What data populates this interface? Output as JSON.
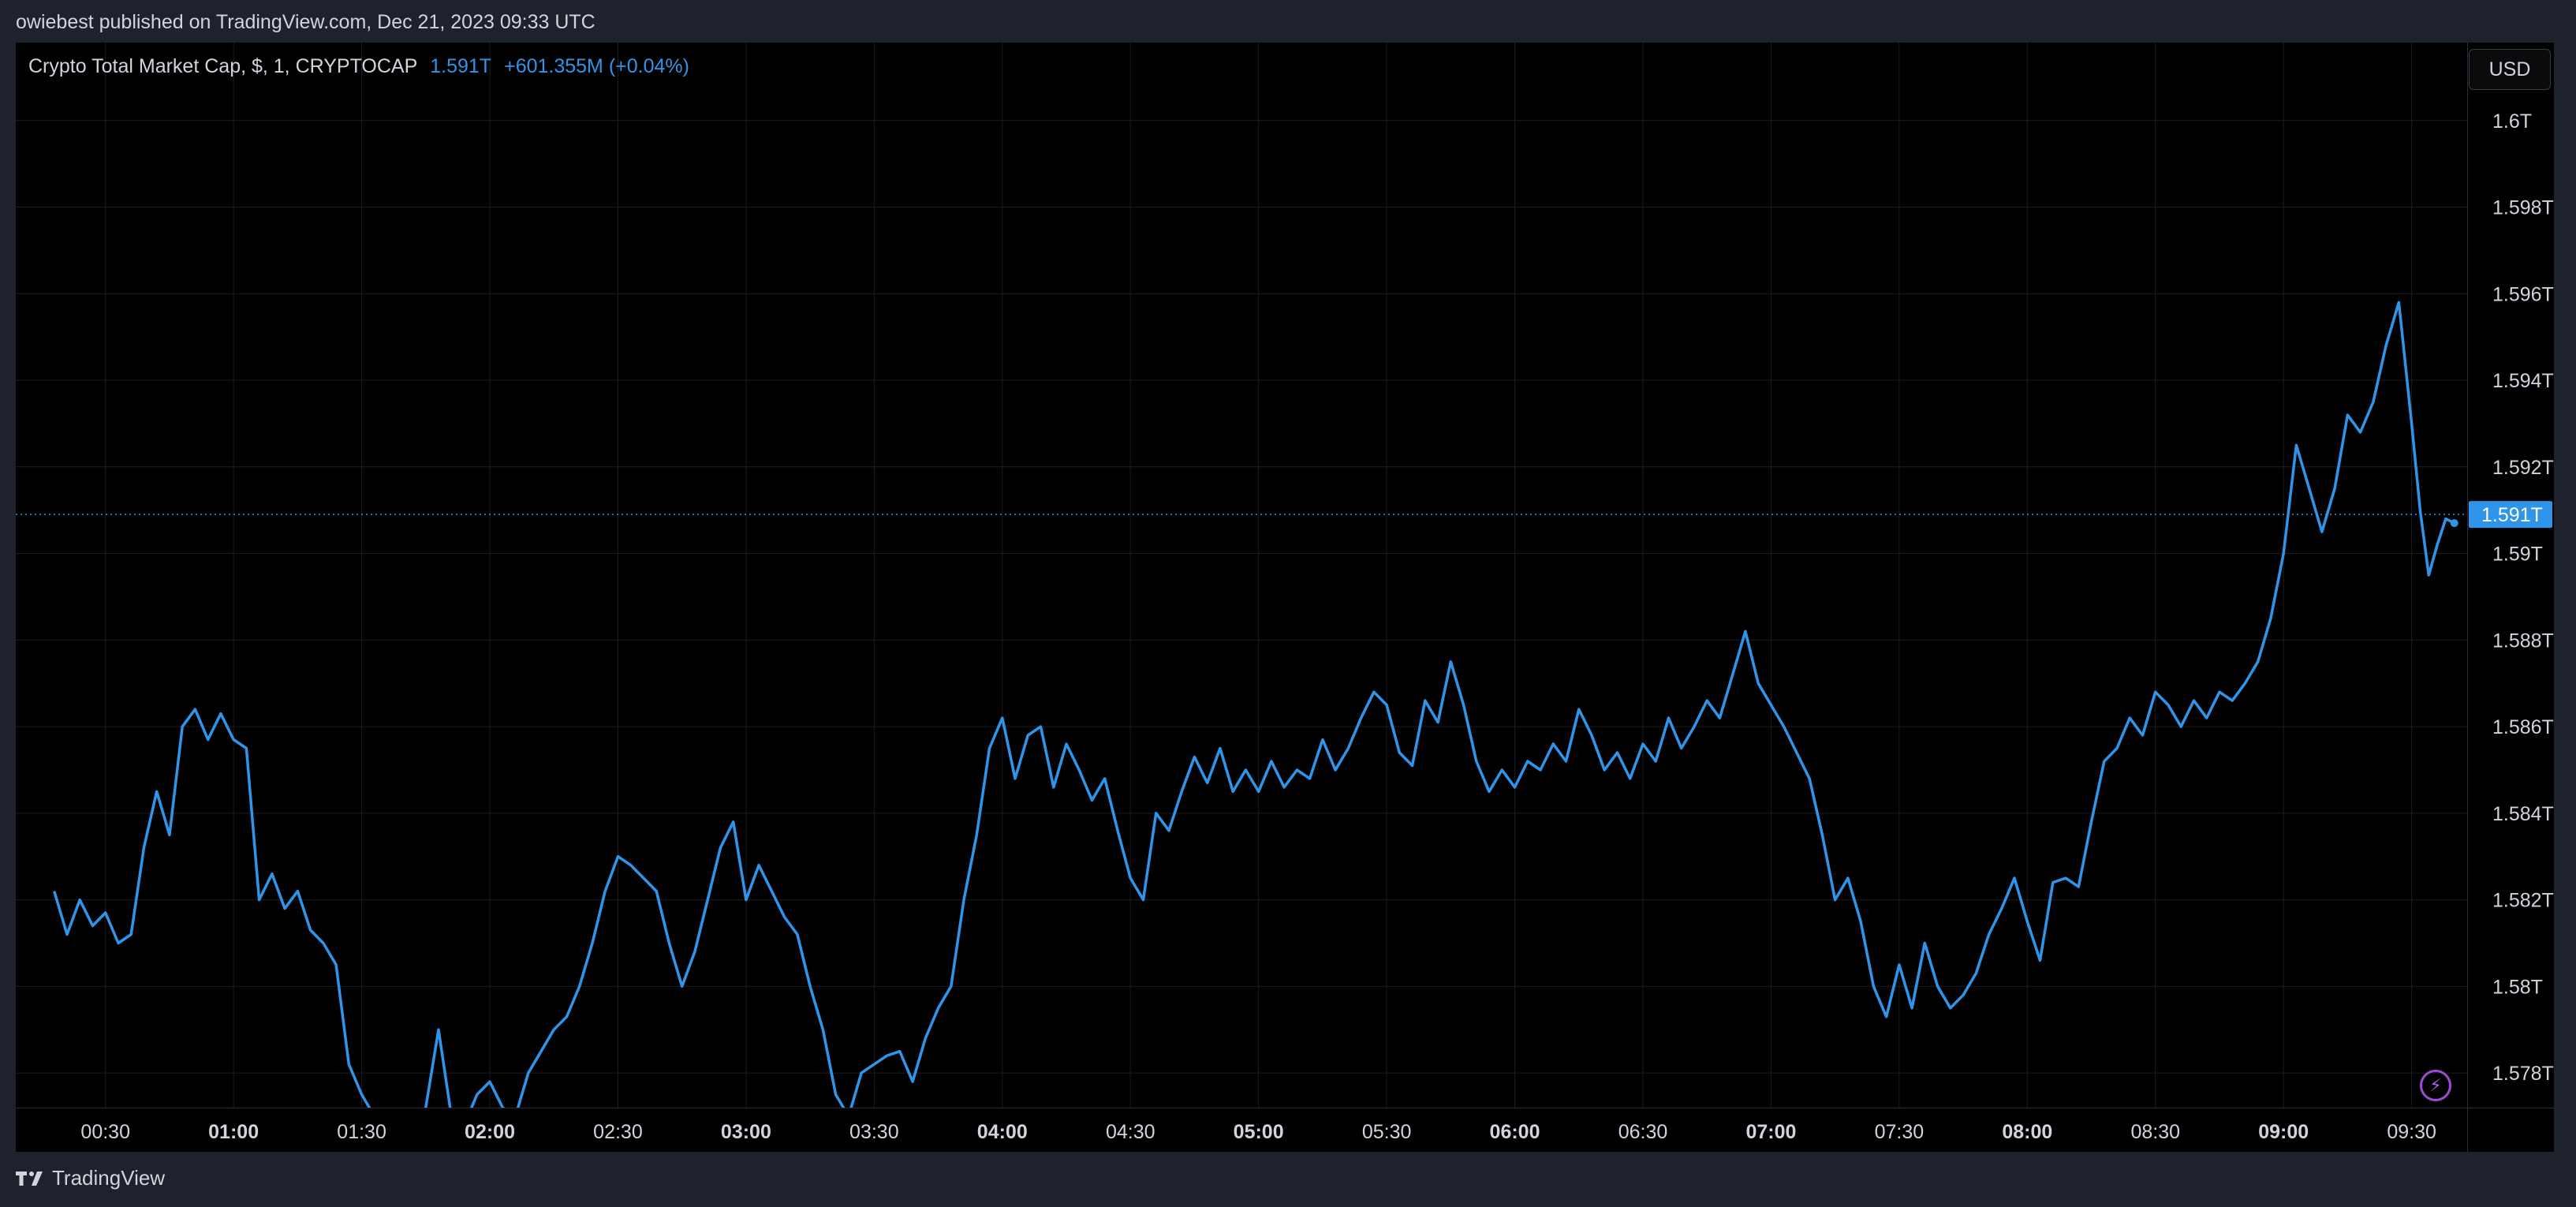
{
  "header": {
    "published_line": "owiebest published on TradingView.com, Dec 21, 2023 09:33 UTC"
  },
  "legend": {
    "symbol": "Crypto Total Market Cap, $, 1, CRYPTOCAP",
    "last": "1.591T",
    "change": "+601.355M (+0.04%)"
  },
  "currency_button": {
    "label": "USD"
  },
  "footer": {
    "brand": "TradingView"
  },
  "icons": {
    "bolt": "lightning-icon",
    "logo": "tradingview-logo-icon"
  },
  "colors": {
    "line": "#2f95ea",
    "background": "#000000",
    "grid": "#1b1d22",
    "text": "#d1d4dc"
  },
  "chart_data": {
    "type": "line",
    "x_start": "00:09",
    "x_unit": "minutes",
    "ylim": [
      1.5772,
      1.6018
    ],
    "y_ticks": [
      {
        "value": 1.6,
        "label": "1.6T"
      },
      {
        "value": 1.598,
        "label": "1.598T"
      },
      {
        "value": 1.596,
        "label": "1.596T"
      },
      {
        "value": 1.594,
        "label": "1.594T"
      },
      {
        "value": 1.592,
        "label": "1.592T"
      },
      {
        "value": 1.59,
        "label": "1.59T"
      },
      {
        "value": 1.588,
        "label": "1.588T"
      },
      {
        "value": 1.586,
        "label": "1.586T"
      },
      {
        "value": 1.584,
        "label": "1.584T"
      },
      {
        "value": 1.582,
        "label": "1.582T"
      },
      {
        "value": 1.58,
        "label": "1.58T"
      },
      {
        "value": 1.578,
        "label": "1.578T"
      }
    ],
    "x_ticks": [
      {
        "t": 30,
        "label": "00:30",
        "bold": false
      },
      {
        "t": 60,
        "label": "01:00",
        "bold": true
      },
      {
        "t": 90,
        "label": "01:30",
        "bold": false
      },
      {
        "t": 120,
        "label": "02:00",
        "bold": true
      },
      {
        "t": 150,
        "label": "02:30",
        "bold": false
      },
      {
        "t": 180,
        "label": "03:00",
        "bold": true
      },
      {
        "t": 210,
        "label": "03:30",
        "bold": false
      },
      {
        "t": 240,
        "label": "04:00",
        "bold": true
      },
      {
        "t": 270,
        "label": "04:30",
        "bold": false
      },
      {
        "t": 300,
        "label": "05:00",
        "bold": true
      },
      {
        "t": 330,
        "label": "05:30",
        "bold": false
      },
      {
        "t": 360,
        "label": "06:00",
        "bold": true
      },
      {
        "t": 390,
        "label": "06:30",
        "bold": false
      },
      {
        "t": 420,
        "label": "07:00",
        "bold": true
      },
      {
        "t": 450,
        "label": "07:30",
        "bold": false
      },
      {
        "t": 480,
        "label": "08:00",
        "bold": true
      },
      {
        "t": 510,
        "label": "08:30",
        "bold": false
      },
      {
        "t": 540,
        "label": "09:00",
        "bold": true
      },
      {
        "t": 570,
        "label": "09:30",
        "bold": false
      }
    ],
    "last_price": {
      "value": 1.5909,
      "label": "1.591T"
    },
    "series": [
      {
        "points": [
          [
            18,
            1.5822
          ],
          [
            21,
            1.5812
          ],
          [
            24,
            1.582
          ],
          [
            27,
            1.5814
          ],
          [
            30,
            1.5817
          ],
          [
            33,
            1.581
          ],
          [
            36,
            1.5812
          ],
          [
            39,
            1.5832
          ],
          [
            42,
            1.5845
          ],
          [
            45,
            1.5835
          ],
          [
            48,
            1.586
          ],
          [
            51,
            1.5864
          ],
          [
            54,
            1.5857
          ],
          [
            57,
            1.5863
          ],
          [
            60,
            1.5857
          ],
          [
            63,
            1.5855
          ],
          [
            66,
            1.582
          ],
          [
            69,
            1.5826
          ],
          [
            72,
            1.5818
          ],
          [
            75,
            1.5822
          ],
          [
            78,
            1.5813
          ],
          [
            81,
            1.581
          ],
          [
            84,
            1.5805
          ],
          [
            87,
            1.5782
          ],
          [
            90,
            1.5775
          ],
          [
            93,
            1.577
          ],
          [
            96,
            1.5768
          ],
          [
            99,
            1.577
          ],
          [
            102,
            1.5768
          ],
          [
            105,
            1.5772
          ],
          [
            108,
            1.579
          ],
          [
            111,
            1.577
          ],
          [
            114,
            1.5768
          ],
          [
            117,
            1.5775
          ],
          [
            120,
            1.5778
          ],
          [
            123,
            1.5772
          ],
          [
            126,
            1.577
          ],
          [
            129,
            1.578
          ],
          [
            132,
            1.5785
          ],
          [
            135,
            1.579
          ],
          [
            138,
            1.5793
          ],
          [
            141,
            1.58
          ],
          [
            144,
            1.581
          ],
          [
            147,
            1.5822
          ],
          [
            150,
            1.583
          ],
          [
            153,
            1.5828
          ],
          [
            156,
            1.5825
          ],
          [
            159,
            1.5822
          ],
          [
            162,
            1.581
          ],
          [
            165,
            1.58
          ],
          [
            168,
            1.5808
          ],
          [
            171,
            1.582
          ],
          [
            174,
            1.5832
          ],
          [
            177,
            1.5838
          ],
          [
            180,
            1.582
          ],
          [
            183,
            1.5828
          ],
          [
            186,
            1.5822
          ],
          [
            189,
            1.5816
          ],
          [
            192,
            1.5812
          ],
          [
            195,
            1.58
          ],
          [
            198,
            1.579
          ],
          [
            201,
            1.5775
          ],
          [
            204,
            1.577
          ],
          [
            207,
            1.578
          ],
          [
            210,
            1.5782
          ],
          [
            213,
            1.5784
          ],
          [
            216,
            1.5785
          ],
          [
            219,
            1.5778
          ],
          [
            222,
            1.5788
          ],
          [
            225,
            1.5795
          ],
          [
            228,
            1.58
          ],
          [
            231,
            1.582
          ],
          [
            234,
            1.5835
          ],
          [
            237,
            1.5855
          ],
          [
            240,
            1.5862
          ],
          [
            243,
            1.5848
          ],
          [
            246,
            1.5858
          ],
          [
            249,
            1.586
          ],
          [
            252,
            1.5846
          ],
          [
            255,
            1.5856
          ],
          [
            258,
            1.585
          ],
          [
            261,
            1.5843
          ],
          [
            264,
            1.5848
          ],
          [
            267,
            1.5836
          ],
          [
            270,
            1.5825
          ],
          [
            273,
            1.582
          ],
          [
            276,
            1.584
          ],
          [
            279,
            1.5836
          ],
          [
            282,
            1.5845
          ],
          [
            285,
            1.5853
          ],
          [
            288,
            1.5847
          ],
          [
            291,
            1.5855
          ],
          [
            294,
            1.5845
          ],
          [
            297,
            1.585
          ],
          [
            300,
            1.5845
          ],
          [
            303,
            1.5852
          ],
          [
            306,
            1.5846
          ],
          [
            309,
            1.585
          ],
          [
            312,
            1.5848
          ],
          [
            315,
            1.5857
          ],
          [
            318,
            1.585
          ],
          [
            321,
            1.5855
          ],
          [
            324,
            1.5862
          ],
          [
            327,
            1.5868
          ],
          [
            330,
            1.5865
          ],
          [
            333,
            1.5854
          ],
          [
            336,
            1.5851
          ],
          [
            339,
            1.5866
          ],
          [
            342,
            1.5861
          ],
          [
            345,
            1.5875
          ],
          [
            348,
            1.5865
          ],
          [
            351,
            1.5852
          ],
          [
            354,
            1.5845
          ],
          [
            357,
            1.585
          ],
          [
            360,
            1.5846
          ],
          [
            363,
            1.5852
          ],
          [
            366,
            1.585
          ],
          [
            369,
            1.5856
          ],
          [
            372,
            1.5852
          ],
          [
            375,
            1.5864
          ],
          [
            378,
            1.5858
          ],
          [
            381,
            1.585
          ],
          [
            384,
            1.5854
          ],
          [
            387,
            1.5848
          ],
          [
            390,
            1.5856
          ],
          [
            393,
            1.5852
          ],
          [
            396,
            1.5862
          ],
          [
            399,
            1.5855
          ],
          [
            402,
            1.586
          ],
          [
            405,
            1.5866
          ],
          [
            408,
            1.5862
          ],
          [
            411,
            1.5872
          ],
          [
            414,
            1.5882
          ],
          [
            417,
            1.587
          ],
          [
            420,
            1.5865
          ],
          [
            423,
            1.586
          ],
          [
            426,
            1.5854
          ],
          [
            429,
            1.5848
          ],
          [
            432,
            1.5835
          ],
          [
            435,
            1.582
          ],
          [
            438,
            1.5825
          ],
          [
            441,
            1.5815
          ],
          [
            444,
            1.58
          ],
          [
            447,
            1.5793
          ],
          [
            450,
            1.5805
          ],
          [
            453,
            1.5795
          ],
          [
            456,
            1.581
          ],
          [
            459,
            1.58
          ],
          [
            462,
            1.5795
          ],
          [
            465,
            1.5798
          ],
          [
            468,
            1.5803
          ],
          [
            471,
            1.5812
          ],
          [
            474,
            1.5818
          ],
          [
            477,
            1.5825
          ],
          [
            480,
            1.5815
          ],
          [
            483,
            1.5806
          ],
          [
            486,
            1.5824
          ],
          [
            489,
            1.5825
          ],
          [
            492,
            1.5823
          ],
          [
            495,
            1.5838
          ],
          [
            498,
            1.5852
          ],
          [
            501,
            1.5855
          ],
          [
            504,
            1.5862
          ],
          [
            507,
            1.5858
          ],
          [
            510,
            1.5868
          ],
          [
            513,
            1.5865
          ],
          [
            516,
            1.586
          ],
          [
            519,
            1.5866
          ],
          [
            522,
            1.5862
          ],
          [
            525,
            1.5868
          ],
          [
            528,
            1.5866
          ],
          [
            531,
            1.587
          ],
          [
            534,
            1.5875
          ],
          [
            537,
            1.5885
          ],
          [
            540,
            1.59
          ],
          [
            543,
            1.5925
          ],
          [
            546,
            1.5915
          ],
          [
            549,
            1.5905
          ],
          [
            552,
            1.5915
          ],
          [
            555,
            1.5932
          ],
          [
            558,
            1.5928
          ],
          [
            561,
            1.5935
          ],
          [
            564,
            1.5948
          ],
          [
            567,
            1.5958
          ],
          [
            570,
            1.593
          ],
          [
            572,
            1.591
          ],
          [
            574,
            1.5895
          ],
          [
            576,
            1.5902
          ],
          [
            578,
            1.5908
          ],
          [
            580,
            1.5907
          ]
        ]
      }
    ]
  }
}
